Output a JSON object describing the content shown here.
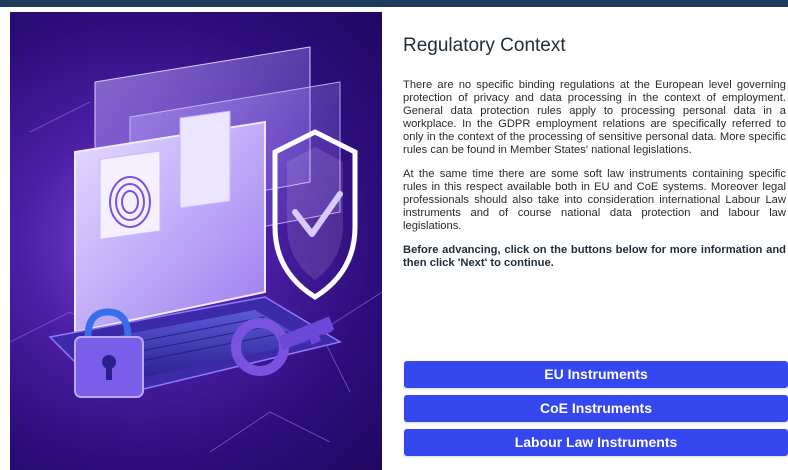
{
  "page": {
    "title": "Regulatory Context",
    "paragraphs": [
      "There are no specific binding regulations at the European level governing protection of privacy and data processing in the context of employment. General data protection rules apply to processing personal data in a workplace. In the GDPR employment relations are specifically referred to only in the context of the processing of sensitive personal data. More specific rules can be found in Member States' national legislations.",
      "At the same time there are some soft law instruments containing specific rules in this respect available  both in EU and CoE systems. Moreover legal professionals should also take into consideration international Labour Law instruments and of course national data protection and labour law legislations."
    ],
    "instruction": "Before advancing, click on the buttons below for more information and then click 'Next' to continue."
  },
  "buttons": {
    "eu": "EU Instruments",
    "coe": "CoE Instruments",
    "labour": "Labour Law Instruments"
  },
  "colors": {
    "button": "#3548f0",
    "topbar": "#1d3b5a",
    "illustration_bg": "#3a1590"
  }
}
